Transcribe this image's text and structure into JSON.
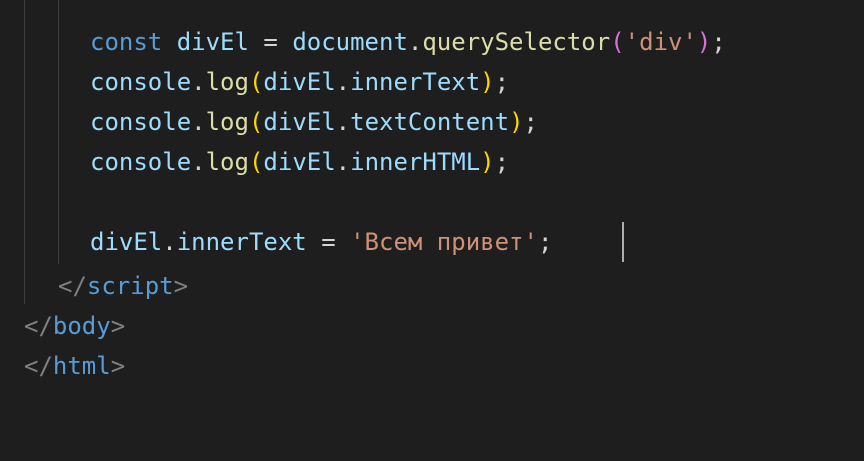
{
  "editor": {
    "colors": {
      "background": "#1e1e1e",
      "keyword": "#569cd6",
      "variable": "#9cdcfe",
      "function": "#dcdcaa",
      "string": "#ce9178",
      "bracket_level_1": "#ffd700",
      "bracket_level_2": "#da70d6",
      "tag": "#569cd6",
      "angle_bracket": "#808080"
    },
    "lines": [
      {
        "tokens": [
          {
            "text": "const",
            "kind": "kw"
          },
          {
            "text": " ",
            "kind": "pun"
          },
          {
            "text": "divEl",
            "kind": "var"
          },
          {
            "text": " = ",
            "kind": "pun"
          },
          {
            "text": "document",
            "kind": "var"
          },
          {
            "text": ".",
            "kind": "pun"
          },
          {
            "text": "querySelector",
            "kind": "fn"
          },
          {
            "text": "(",
            "kind": "p2"
          },
          {
            "text": "'div'",
            "kind": "str"
          },
          {
            "text": ")",
            "kind": "p2"
          },
          {
            "text": ";",
            "kind": "pun"
          }
        ]
      },
      {
        "tokens": [
          {
            "text": "console",
            "kind": "var"
          },
          {
            "text": ".",
            "kind": "pun"
          },
          {
            "text": "log",
            "kind": "fn"
          },
          {
            "text": "(",
            "kind": "p1"
          },
          {
            "text": "divEl",
            "kind": "var"
          },
          {
            "text": ".",
            "kind": "pun"
          },
          {
            "text": "innerText",
            "kind": "var"
          },
          {
            "text": ")",
            "kind": "p1"
          },
          {
            "text": ";",
            "kind": "pun"
          }
        ]
      },
      {
        "tokens": [
          {
            "text": "console",
            "kind": "var"
          },
          {
            "text": ".",
            "kind": "pun"
          },
          {
            "text": "log",
            "kind": "fn"
          },
          {
            "text": "(",
            "kind": "p1"
          },
          {
            "text": "divEl",
            "kind": "var"
          },
          {
            "text": ".",
            "kind": "pun"
          },
          {
            "text": "textContent",
            "kind": "var"
          },
          {
            "text": ")",
            "kind": "p1"
          },
          {
            "text": ";",
            "kind": "pun"
          }
        ]
      },
      {
        "tokens": [
          {
            "text": "console",
            "kind": "var"
          },
          {
            "text": ".",
            "kind": "pun"
          },
          {
            "text": "log",
            "kind": "fn"
          },
          {
            "text": "(",
            "kind": "p1"
          },
          {
            "text": "divEl",
            "kind": "var"
          },
          {
            "text": ".",
            "kind": "pun"
          },
          {
            "text": "innerHTML",
            "kind": "var"
          },
          {
            "text": ")",
            "kind": "p1"
          },
          {
            "text": ";",
            "kind": "pun"
          }
        ]
      },
      {
        "tokens": []
      },
      {
        "tokens": [
          {
            "text": "divEl",
            "kind": "var"
          },
          {
            "text": ".",
            "kind": "pun"
          },
          {
            "text": "innerText",
            "kind": "var"
          },
          {
            "text": " = ",
            "kind": "pun"
          },
          {
            "text": "'Всем привет'",
            "kind": "str"
          },
          {
            "text": ";",
            "kind": "pun"
          }
        ]
      },
      {
        "tokens": [
          {
            "text": "</",
            "kind": "ang"
          },
          {
            "text": "script",
            "kind": "tag"
          },
          {
            "text": ">",
            "kind": "ang"
          }
        ]
      },
      {
        "tokens": [
          {
            "text": "</",
            "kind": "ang"
          },
          {
            "text": "body",
            "kind": "tag"
          },
          {
            "text": ">",
            "kind": "ang"
          }
        ]
      },
      {
        "tokens": [
          {
            "text": "</",
            "kind": "ang"
          },
          {
            "text": "html",
            "kind": "tag"
          },
          {
            "text": ">",
            "kind": "ang"
          }
        ]
      }
    ]
  }
}
